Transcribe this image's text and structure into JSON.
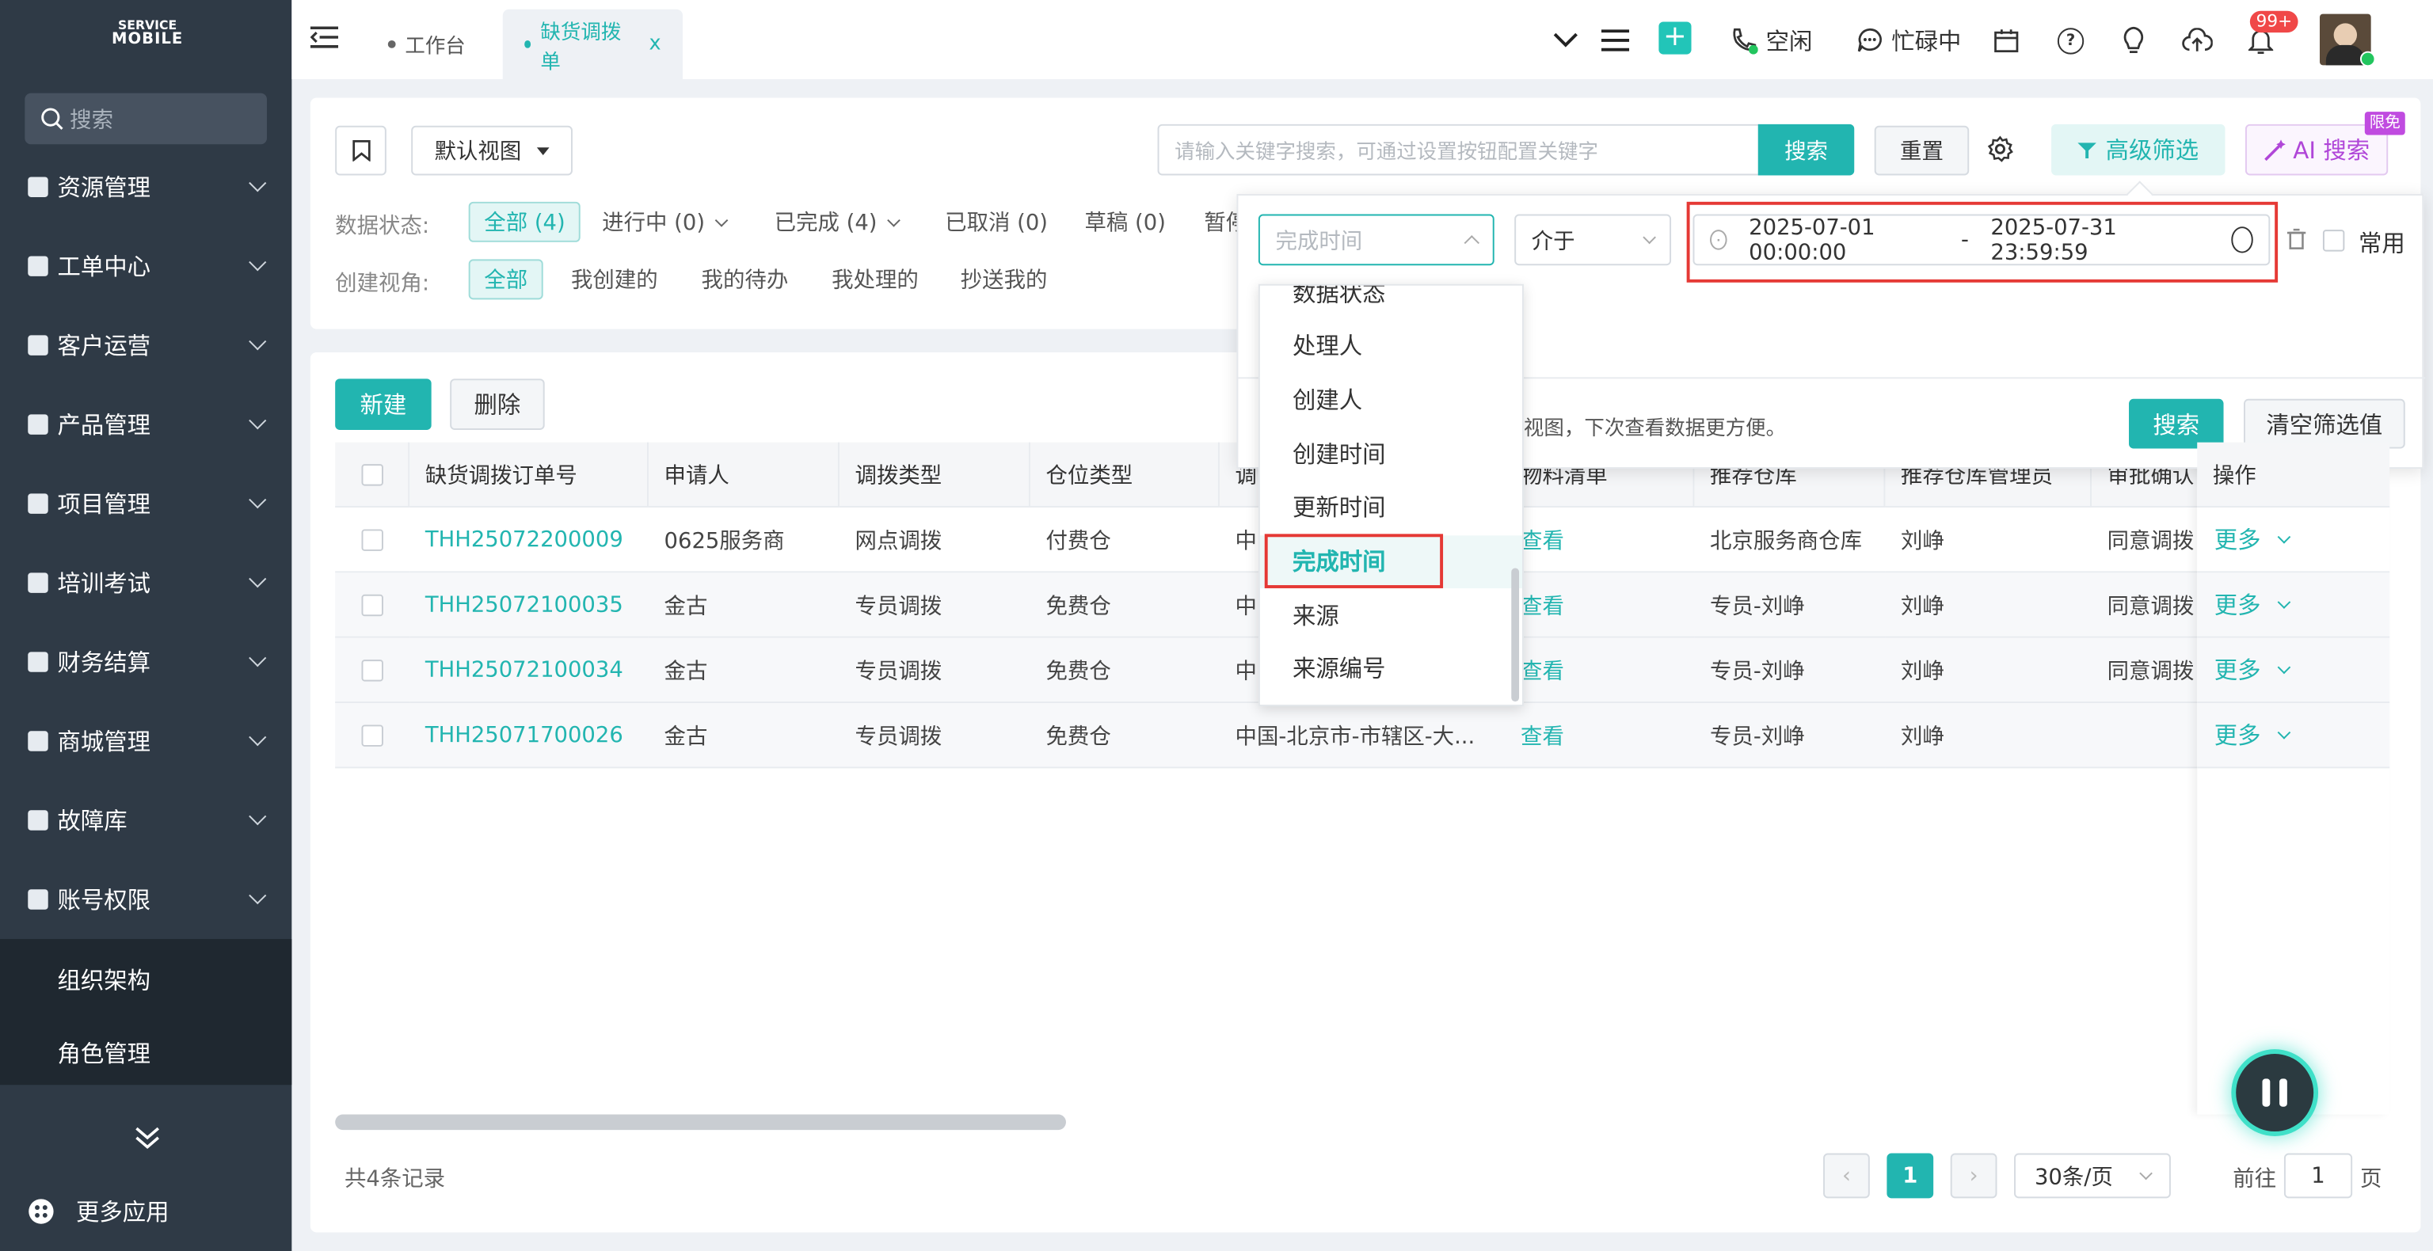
{
  "sidebar": {
    "logo_small": "SERVICE",
    "logo_big": "MOBILE",
    "search_placeholder": "搜索",
    "menu": [
      {
        "label": "资源管理",
        "icon": "resource-icon"
      },
      {
        "label": "工单中心",
        "icon": "ticket-icon"
      },
      {
        "label": "客户运营",
        "icon": "customer-icon"
      },
      {
        "label": "产品管理",
        "icon": "product-icon"
      },
      {
        "label": "项目管理",
        "icon": "project-icon"
      },
      {
        "label": "培训考试",
        "icon": "home-icon"
      },
      {
        "label": "财务结算",
        "icon": "yen-icon"
      },
      {
        "label": "商城管理",
        "icon": "shop-icon"
      },
      {
        "label": "故障库",
        "icon": "fault-icon"
      },
      {
        "label": "账号权限",
        "icon": "account-icon"
      }
    ],
    "submenu": [
      "组织架构",
      "角色管理"
    ],
    "more_apps": "更多应用"
  },
  "topbar": {
    "tabs": [
      {
        "label": "工作台"
      },
      {
        "label": "缺货调拨单",
        "close": "x"
      }
    ],
    "status_idle": "空闲",
    "status_busy": "忙碌中",
    "badge": "99+"
  },
  "filter": {
    "view_select": "默认视图",
    "search_placeholder": "请输入关键字搜索，可通过设置按钮配置关键字",
    "search_btn": "搜索",
    "reset_btn": "重置",
    "advanced_btn": "高级筛选",
    "ai_btn": "AI 搜索",
    "ai_badge": "限免",
    "status_label": "数据状态:",
    "status_chips": [
      "全部 (4)",
      "进行中 (0)",
      "已完成 (4)",
      "已取消 (0)",
      "草稿 (0)",
      "暂停"
    ],
    "view_label": "创建视角:",
    "view_chips": [
      "全部",
      "我创建的",
      "我的待办",
      "我处理的",
      "抄送我的"
    ]
  },
  "actions": {
    "new_btn": "新建",
    "delete_btn": "删除"
  },
  "table": {
    "headers": [
      "缺货调拨订单号",
      "申请人",
      "调拨类型",
      "仓位类型",
      "调",
      "物料清单",
      "推荐仓库",
      "推荐仓库管理员",
      "审批确认",
      "操作"
    ],
    "rows": [
      {
        "id": "THH25072200009",
        "applicant": "0625服务商",
        "type": "网点调拨",
        "pos": "付费仓",
        "addr": "中",
        "list": "查看",
        "wh": "北京服务商仓库",
        "admin": "刘峥",
        "approve": "同意调拨",
        "op": "更多"
      },
      {
        "id": "THH25072100035",
        "applicant": "金古",
        "type": "专员调拨",
        "pos": "免费仓",
        "addr": "中",
        "list": "查看",
        "wh": "专员-刘峥",
        "admin": "刘峥",
        "approve": "同意调拨",
        "op": "更多"
      },
      {
        "id": "THH25072100034",
        "applicant": "金古",
        "type": "专员调拨",
        "pos": "免费仓",
        "addr": "中",
        "list": "查看",
        "wh": "专员-刘峥",
        "admin": "刘峥",
        "approve": "同意调拨",
        "op": "更多"
      },
      {
        "id": "THH25071700026",
        "applicant": "金古",
        "type": "专员调拨",
        "pos": "免费仓",
        "addr": "中国-北京市-市辖区-大...",
        "list": "查看",
        "wh": "专员-刘峥",
        "admin": "刘峥",
        "approve": "",
        "op": "更多"
      }
    ]
  },
  "footer": {
    "total": "共4条记录",
    "page": "1",
    "page_size": "30条/页",
    "goto_label": "前往",
    "goto_value": "1",
    "page_unit": "页"
  },
  "advanced": {
    "field_placeholder": "完成时间",
    "operator": "介于",
    "date_start": "2025-07-01 00:00:00",
    "date_sep": "-",
    "date_end": "2025-07-31 23:59:59",
    "common_label": "常用",
    "hint": "视图，下次查看数据更方便。",
    "search_btn": "搜索",
    "clear_btn": "清空筛选值"
  },
  "dropdown": {
    "options": [
      "数据状态",
      "处理人",
      "创建人",
      "创建时间",
      "更新时间",
      "完成时间",
      "来源",
      "来源编号"
    ],
    "selected": "完成时间"
  }
}
